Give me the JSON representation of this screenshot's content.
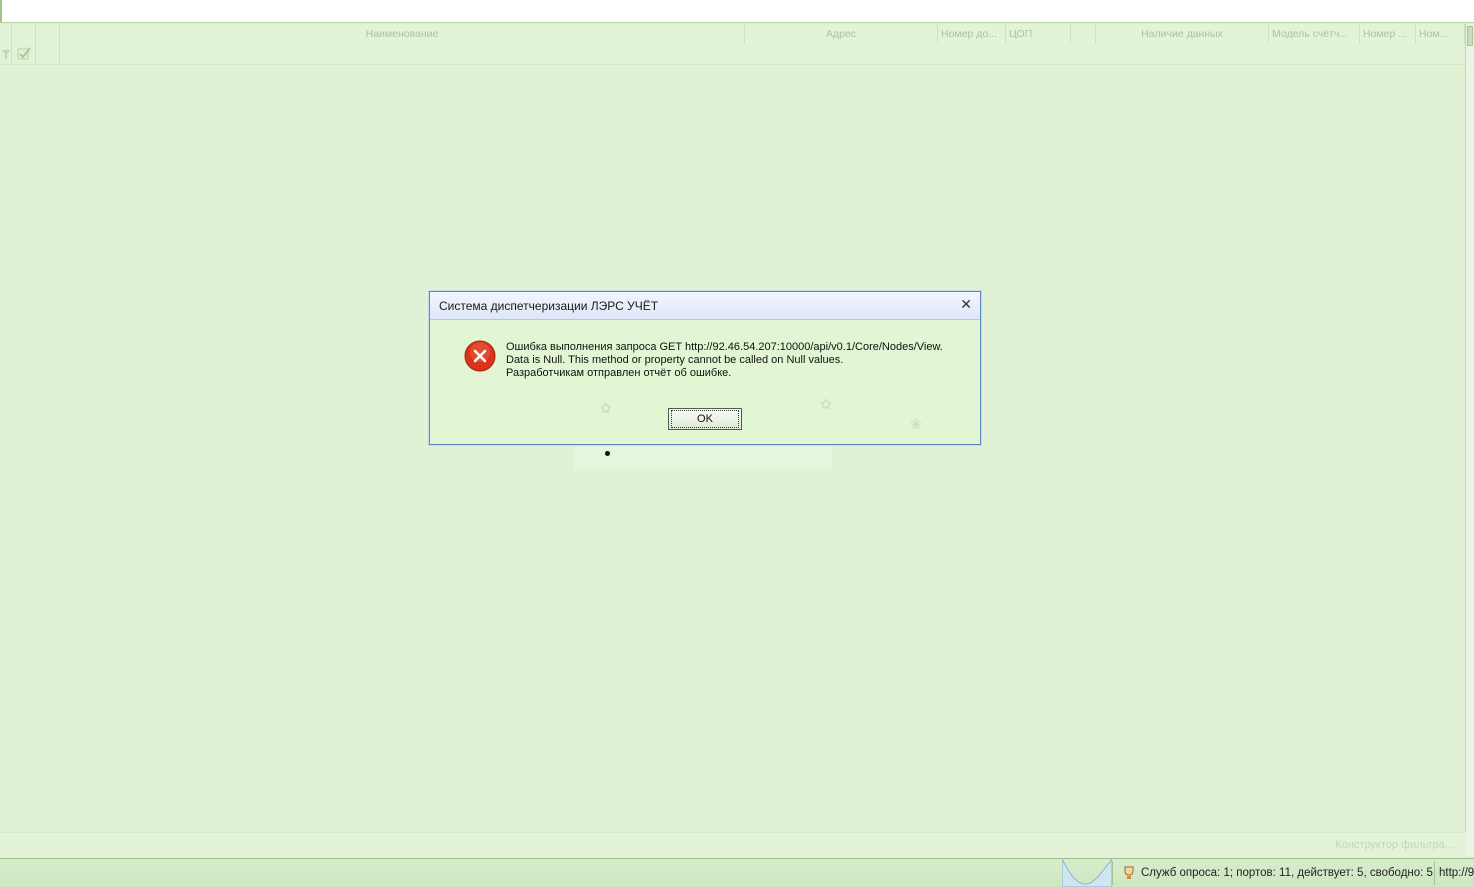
{
  "grid": {
    "columns": [
      {
        "label": ""
      },
      {
        "label": ""
      },
      {
        "label": ""
      },
      {
        "label": "Наименование"
      },
      {
        "label": "Адрес"
      },
      {
        "label": "Номер до..."
      },
      {
        "label": "ЦОП"
      },
      {
        "label": ""
      },
      {
        "label": "Наличие данных"
      },
      {
        "label": "Модель счётч..."
      },
      {
        "label": "Номер ..."
      },
      {
        "label": "Ном..."
      }
    ]
  },
  "filter_bar": {
    "constructor_link": "Конструктор фильтра..."
  },
  "dialog": {
    "title": "Система диспетчеризации ЛЭРС УЧЁТ",
    "close_symbol": "✕",
    "icon": "error-icon",
    "message_lines": [
      "Ошибка выполнения запроса GET http://92.46.54.207:10000/api/v0.1/Core/Nodes/View.",
      "Data is Null. This method or property cannot be called on Null values.",
      "Разработчикам отправлен отчёт об ошибке."
    ],
    "ok_label": "OK"
  },
  "statusbar": {
    "poll_status": "Служб опроса: 1; портов: 11, действует: 5, свободно: 5",
    "url_fragment": "http://9"
  },
  "colors": {
    "background": "#dff0d3",
    "accent": "#5d86c6",
    "error": "#d9341b"
  }
}
